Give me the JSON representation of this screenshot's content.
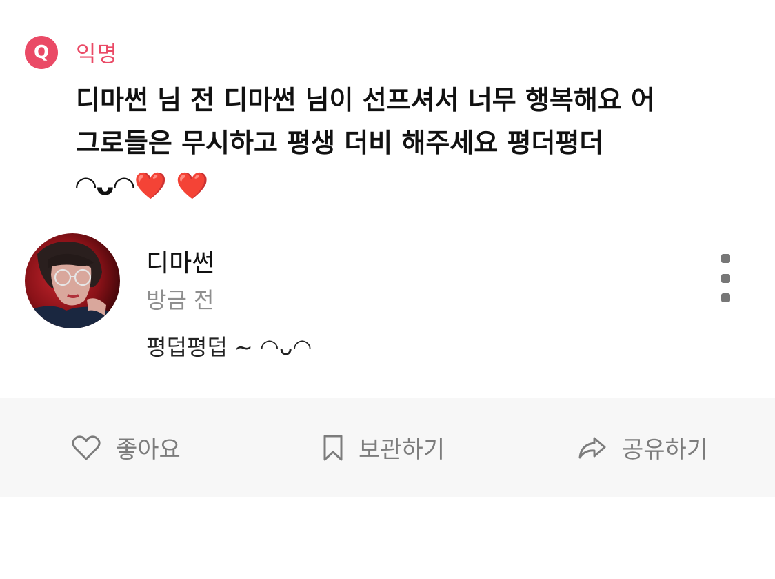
{
  "question": {
    "badge": "Q",
    "author": "익명",
    "text": "디마썬 님 전 디마썬 님이 선프셔서 너무 행복해요 어\n그로들은 무시하고 평생 더비 해주세요 평더평더\n◠ᴗ◠❤️ ❤️"
  },
  "reply": {
    "name": "디마썬",
    "time": "방금 전",
    "text": "평덥평덥 ~ ◠ᴗ◠"
  },
  "actions": {
    "like_label": "좋아요",
    "save_label": "보관하기",
    "share_label": "공유하기"
  },
  "colors": {
    "accent": "#ea4a66",
    "muted_text": "#8e8e8e",
    "action_bar_bg": "#f7f7f7"
  },
  "icons": {
    "like": "heart-outline-icon",
    "save": "bookmark-outline-icon",
    "share": "share-arrow-icon",
    "more": "more-vertical-icon"
  }
}
